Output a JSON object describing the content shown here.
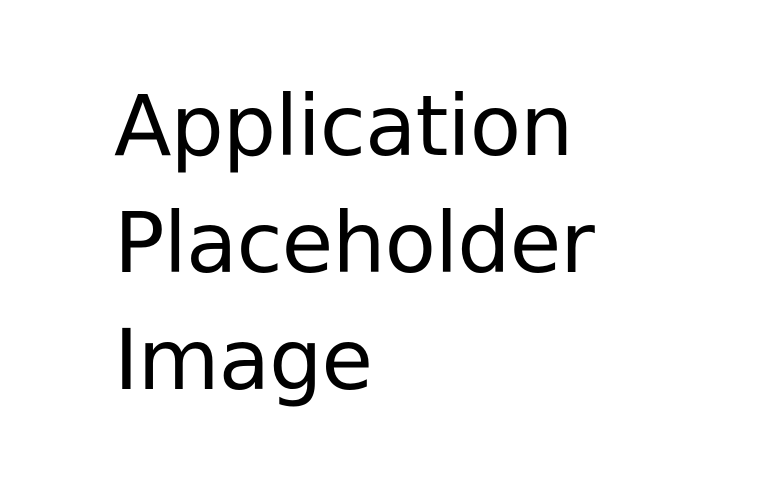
{
  "placeholder": {
    "lines": [
      "Application",
      "Placeholder",
      "Image"
    ]
  },
  "colors": {
    "background": "#ffffff",
    "text": "#000000"
  }
}
